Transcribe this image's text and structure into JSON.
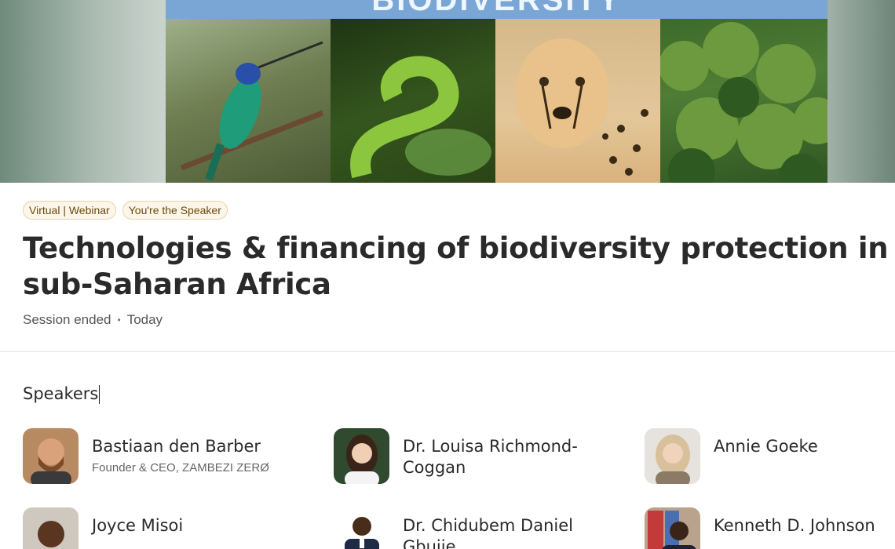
{
  "banner": {
    "word": "BIODIVERSITY"
  },
  "event": {
    "tags": [
      "Virtual | Webinar",
      "You're the Speaker"
    ],
    "title": "Technologies & financing of biodiversity protection in sub-Saharan Africa",
    "status": "Session ended",
    "separator": "•",
    "date": "Today"
  },
  "speakers": {
    "heading": "Speakers",
    "items": [
      {
        "name": "Bastiaan den Barber",
        "role": "Founder & CEO, ZAMBEZI ZERØ"
      },
      {
        "name": "Dr. Louisa Richmond-Coggan",
        "role": ""
      },
      {
        "name": "Annie Goeke",
        "role": ""
      },
      {
        "name": "Joyce Misoi",
        "role": ""
      },
      {
        "name": "Dr. Chidubem Daniel Gbujie",
        "role": ""
      },
      {
        "name": "Kenneth D. Johnson",
        "role": ""
      }
    ]
  },
  "colors": {
    "tag_text": "#6b4a0f",
    "tag_border": "#e7d3ad",
    "banner_sky": "#7aa6d6"
  }
}
